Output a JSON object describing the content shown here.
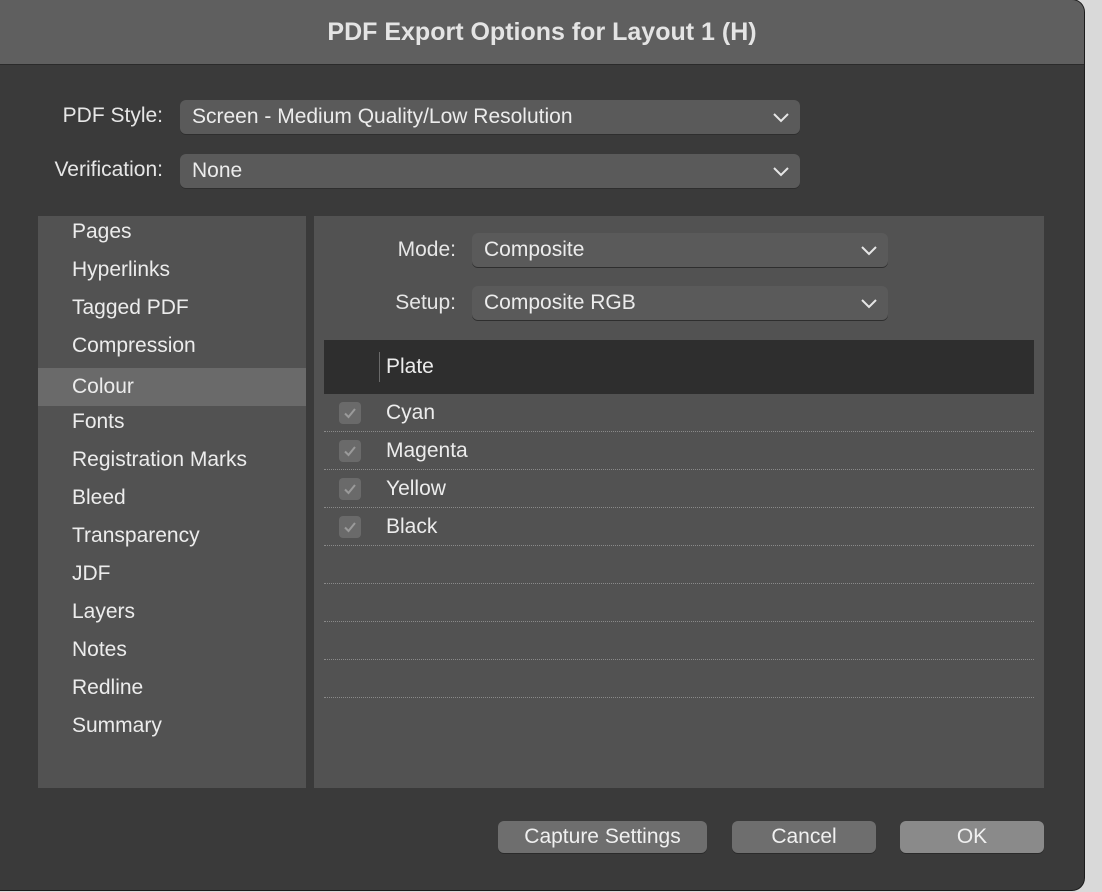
{
  "dialog": {
    "title": "PDF Export Options for Layout 1 (H)"
  },
  "top_fields": {
    "pdf_style_label": "PDF Style:",
    "pdf_style_value": "Screen - Medium Quality/Low Resolution",
    "verification_label": "Verification:",
    "verification_value": "None"
  },
  "sidebar": {
    "items": [
      {
        "label": "Pages"
      },
      {
        "label": "Hyperlinks"
      },
      {
        "label": "Tagged PDF"
      },
      {
        "label": "Compression"
      },
      {
        "label": "Colour"
      },
      {
        "label": "Fonts"
      },
      {
        "label": "Registration Marks"
      },
      {
        "label": "Bleed"
      },
      {
        "label": "Transparency"
      },
      {
        "label": "JDF"
      },
      {
        "label": "Layers"
      },
      {
        "label": "Notes"
      },
      {
        "label": "Redline"
      },
      {
        "label": "Summary"
      }
    ],
    "selected": "Colour"
  },
  "colour_panel": {
    "mode_label": "Mode:",
    "mode_value": "Composite",
    "setup_label": "Setup:",
    "setup_value": "Composite RGB",
    "table_header": "Plate",
    "plates": [
      {
        "name": "Cyan",
        "checked": true
      },
      {
        "name": "Magenta",
        "checked": true
      },
      {
        "name": "Yellow",
        "checked": true
      },
      {
        "name": "Black",
        "checked": true
      }
    ]
  },
  "buttons": {
    "capture_settings": "Capture Settings",
    "cancel": "Cancel",
    "ok": "OK"
  },
  "colors": {
    "dialog_bg": "#3a3a3a",
    "title_bar": "#5f5f5f",
    "panel_bg": "#525252",
    "selected_item": "#6a6a6a",
    "table_header_bg": "#2e2e2e"
  }
}
